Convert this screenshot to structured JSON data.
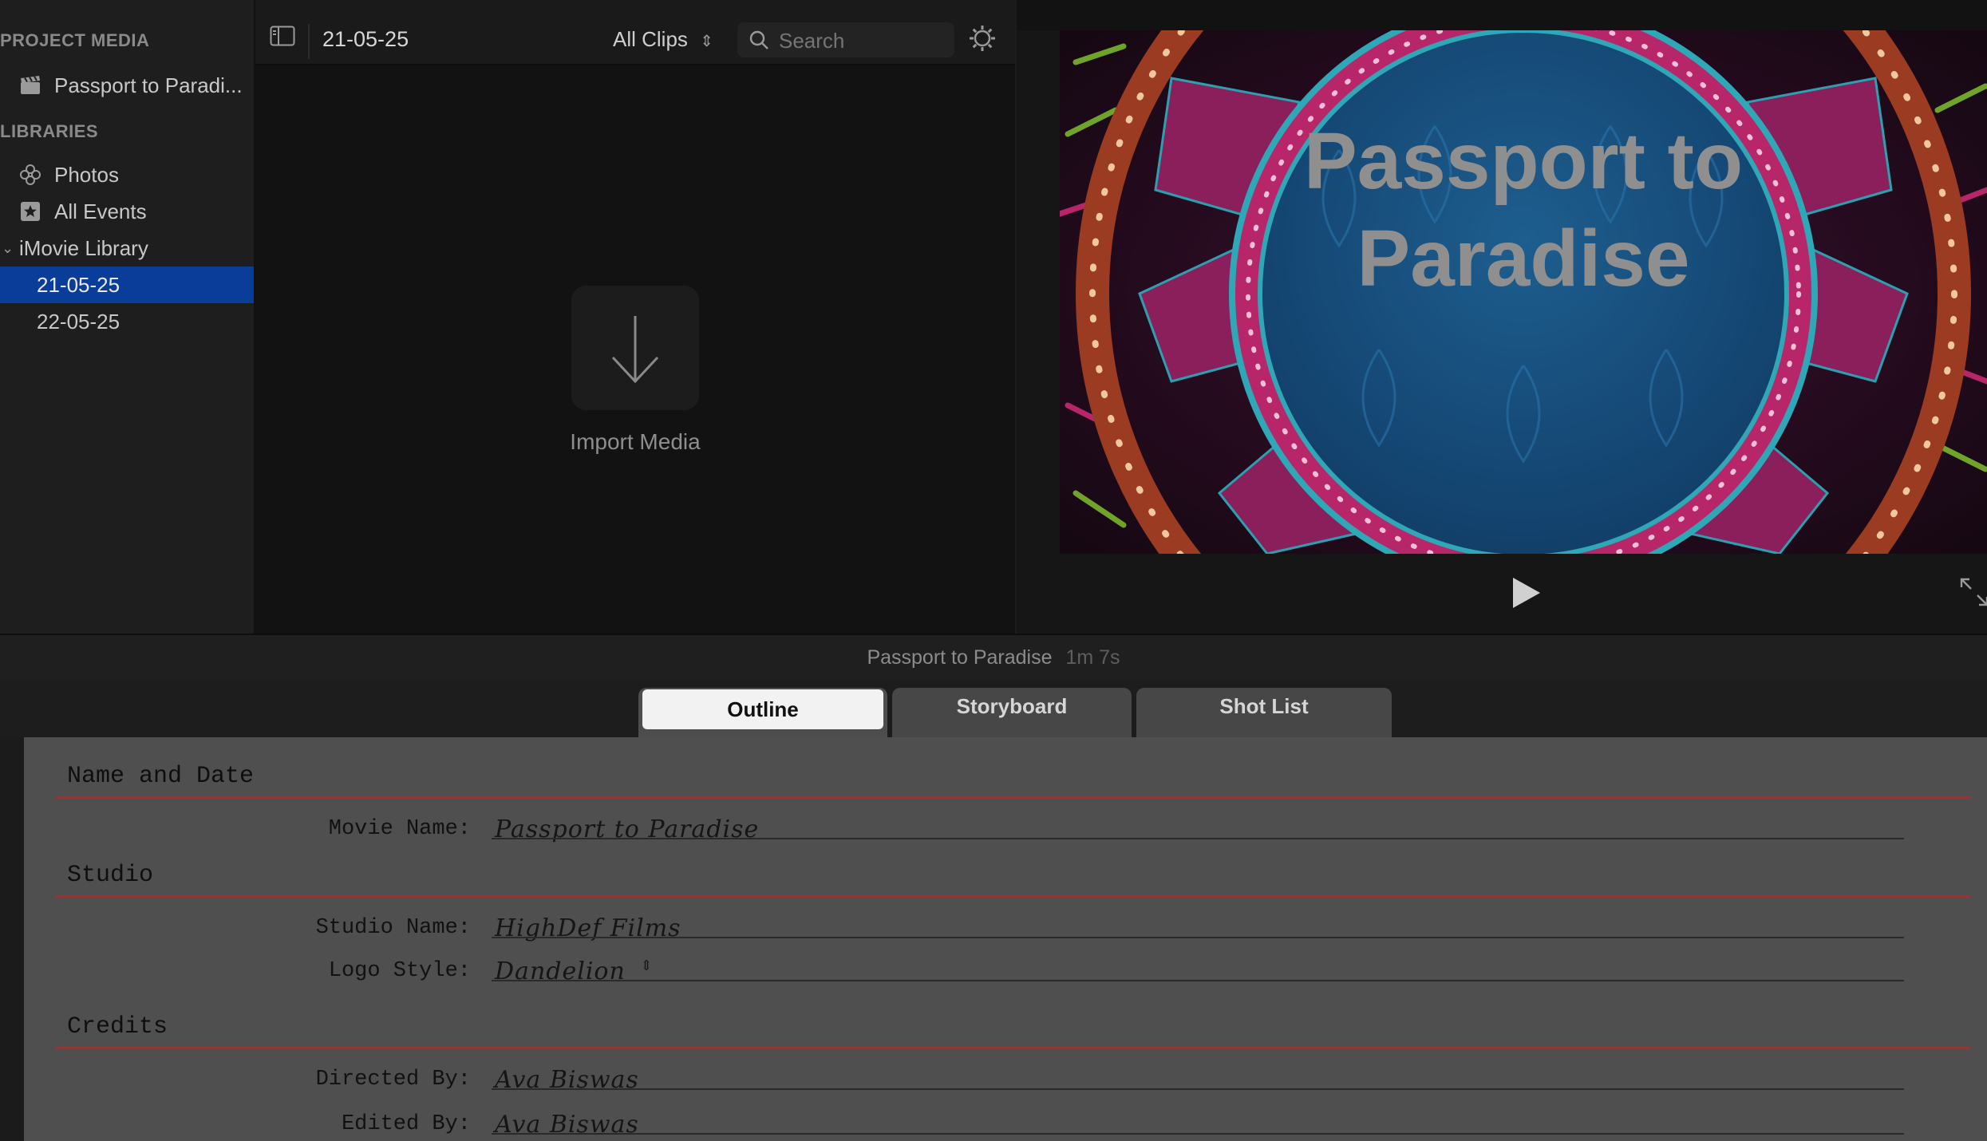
{
  "sidebar": {
    "project_media_heading": "PROJECT MEDIA",
    "project_item": "Passport to Paradi...",
    "libraries_heading": "LIBRARIES",
    "items": [
      {
        "label": "Photos",
        "icon": "photos-icon"
      },
      {
        "label": "All Events",
        "icon": "star-icon"
      },
      {
        "label": "iMovie Library",
        "icon": "chevron-down-icon"
      },
      {
        "label": "21-05-25",
        "selected": true
      },
      {
        "label": "22-05-25",
        "selected": false
      }
    ]
  },
  "browser": {
    "event_title": "21-05-25",
    "filter_label": "All Clips",
    "search_placeholder": "Search",
    "import_label": "Import Media"
  },
  "viewer": {
    "frame_title_line1": "Passport to",
    "frame_title_line2": "Paradise",
    "accent": "#b8266a",
    "ring_color": "#1a6aa0"
  },
  "project": {
    "title": "Passport to Paradise",
    "duration": "1m 7s"
  },
  "tabs": [
    {
      "label": "Outline",
      "active": true
    },
    {
      "label": "Storyboard",
      "active": false
    },
    {
      "label": "Shot List",
      "active": false
    }
  ],
  "outline": {
    "sections": {
      "name_date": "Name and Date",
      "studio": "Studio",
      "credits": "Credits"
    },
    "fields": {
      "movie_name_label": "Movie Name:",
      "movie_name_value": "Passport to Paradise",
      "studio_name_label": "Studio Name:",
      "studio_name_value": "HighDef Films",
      "logo_style_label": "Logo Style:",
      "logo_style_value": "Dandelion",
      "directed_by_label": "Directed By:",
      "directed_by_value": "Ava Biswas",
      "edited_by_label": "Edited By:",
      "edited_by_value": "Ava Biswas"
    }
  }
}
